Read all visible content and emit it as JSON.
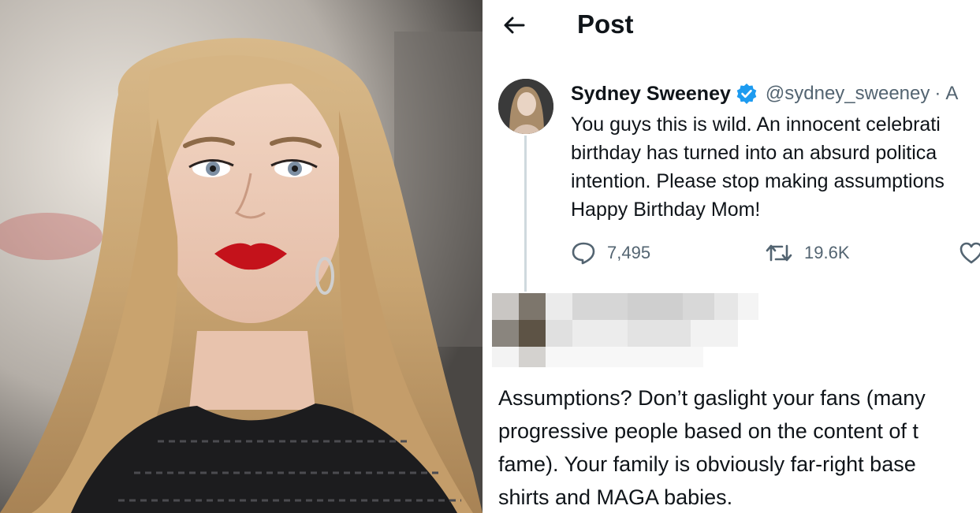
{
  "header": {
    "title": "Post"
  },
  "tweet": {
    "author_name": "Sydney Sweeney",
    "handle": "@sydney_sweeney",
    "separator": "·",
    "date_fragment": "A",
    "text": "You guys this is wild. An innocent celebrati\nbirthday has turned into an absurd politica\nintention. Please stop making assumptions\nHappy Birthday Mom!",
    "replies_count": "7,495",
    "retweets_count": "19.6K"
  },
  "reply": {
    "text": "Assumptions? Don’t gaslight your fans (many\nprogressive people based on the content of t\nfame). Your family is obviously far-right base\nshirts and MAGA babies."
  },
  "colors": {
    "text_primary": "#0f1419",
    "text_secondary": "#536471",
    "verified_blue": "#1d9bf0",
    "thread_line": "#cfd9de"
  },
  "icons": {
    "back": "arrow-left-icon",
    "verified": "verified-badge-icon",
    "reply": "speech-bubble-icon",
    "retweet": "retweet-icon",
    "like": "heart-icon"
  }
}
